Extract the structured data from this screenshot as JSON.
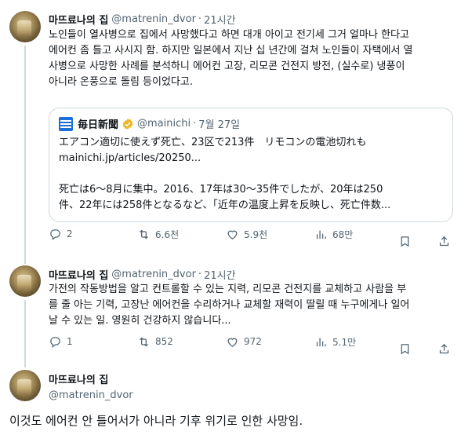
{
  "tweet1": {
    "name": "마뜨료나의 집",
    "handle": "@matrenin_dvor",
    "time": "21시간",
    "lines": [
      "노인들이 열사병으로 집에서 사망했다고 하면 대개 아이고 전기세 그거 얼마나 한다고",
      "에어컨 좀 틀고 사시지 함. 하지만 일본에서 지난 십 년간에 걸쳐 노인들이 자택에서 열",
      "사병으로 사망한 사례를 분석하니 에어컨 고장, 리모콘 건전지 방전, (실수로) 냉풍이",
      "아니라 온풍으로 돌림 등이었다고."
    ],
    "quote": {
      "name": "毎日新聞",
      "handle": "@mainichi",
      "time": "7월 27일",
      "lines": [
        "エアコン適切に使えず死亡、23区で213件　リモコンの電池切れも",
        "mainichi.jp/articles/20250...",
        "",
        "死亡は6～8月に集中。2016、17年は30～35件でしたが、20年は250",
        "件、22年には258件となるなど、「近年の温度上昇を反映し、死亡件数..."
      ]
    },
    "stats": {
      "replies": "2",
      "retweets": "6.6천",
      "likes": "5.9천",
      "views": "68만"
    }
  },
  "tweet2": {
    "name": "마뜨료나의 집",
    "handle": "@matrenin_dvor",
    "time": "21시간",
    "lines": [
      "가전의 작동방법을 알고 컨트롤할 수 있는 지력, 리모콘 건전지를 교체하고 사람을 부",
      "를 줄 아는 기력, 고장난 에어컨을 수리하거나 교체할 재력이 딸릴 때 누구에게나 일어",
      "날 수 있는 일. 영원히 건강하지 않습니다..."
    ],
    "stats": {
      "replies": "1",
      "retweets": "852",
      "likes": "972",
      "views": "5.1만"
    }
  },
  "tweet3": {
    "name": "마뜨료나의 집",
    "handle": "@matrenin_dvor",
    "text": "이것도 에어컨 안 틀어서가 아니라 기후 위기로 인한 사망임."
  }
}
